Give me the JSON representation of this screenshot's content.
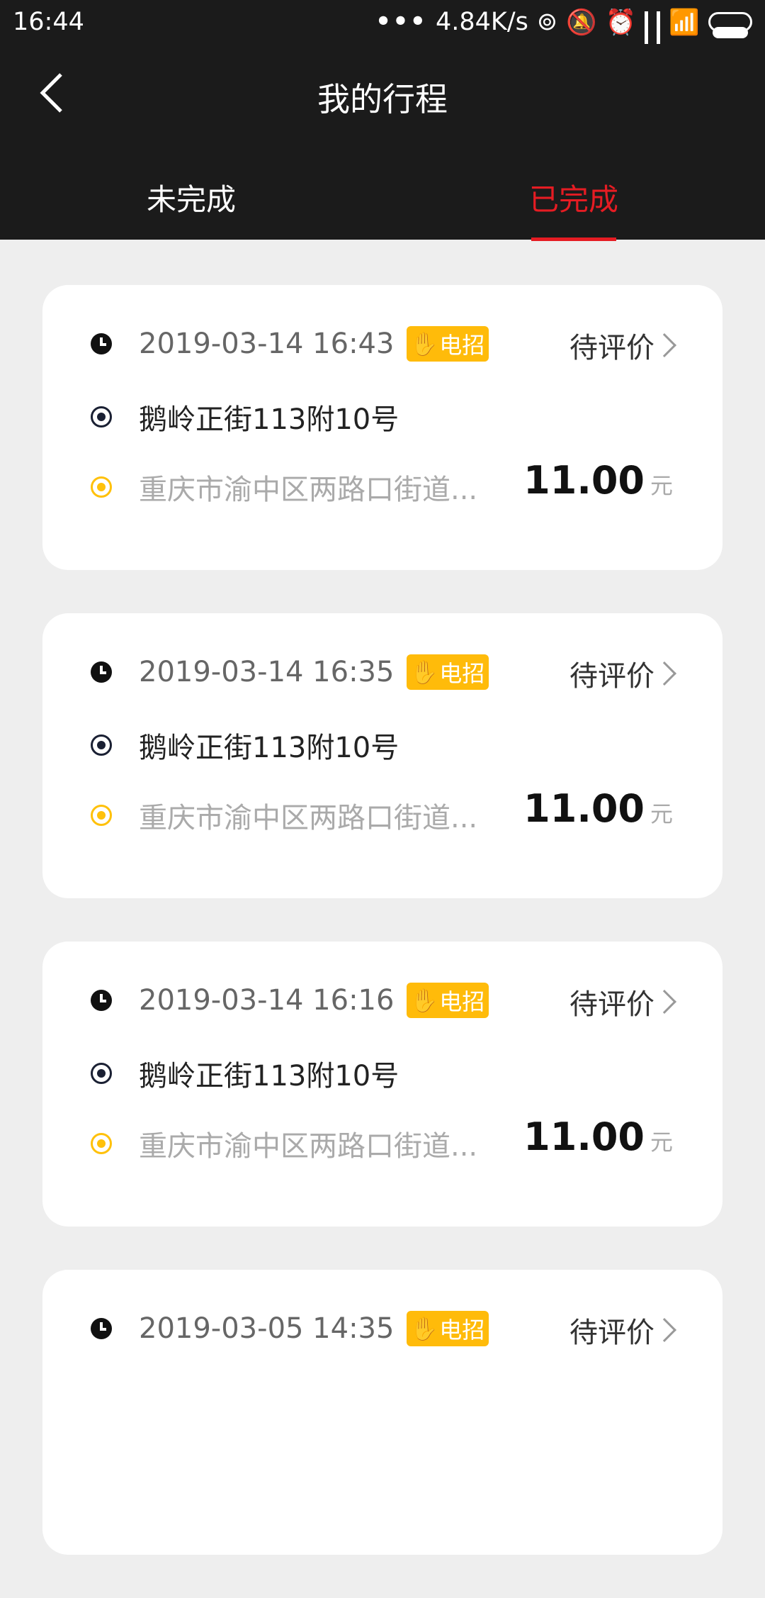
{
  "status_bar": {
    "time": "16:44",
    "network_speed": "4.84K/s",
    "icons": [
      "more-dots-icon",
      "hotspot-icon",
      "mute-icon",
      "alarm-icon",
      "signal-icon",
      "signal-icon",
      "wifi-icon",
      "battery-icon"
    ]
  },
  "header": {
    "back_icon": "chevron-left-icon",
    "title": "我的行程"
  },
  "tabs": [
    {
      "label": "未完成",
      "active": false
    },
    {
      "label": "已完成",
      "active": true
    }
  ],
  "colors": {
    "accent": "#e51c23",
    "header_bg": "#1b1b1b",
    "badge": "#ffbb0a",
    "destination_dot": "#ffc10a"
  },
  "trips": [
    {
      "time": "2019-03-14 16:43",
      "badge": "电招",
      "status": "待评价",
      "start": "鹅岭正街113附10号",
      "destination": "重庆市渝中区两路口街道...",
      "price": "11.00",
      "unit": "元"
    },
    {
      "time": "2019-03-14 16:35",
      "badge": "电招",
      "status": "待评价",
      "start": "鹅岭正街113附10号",
      "destination": "重庆市渝中区两路口街道...",
      "price": "11.00",
      "unit": "元"
    },
    {
      "time": "2019-03-14 16:16",
      "badge": "电招",
      "status": "待评价",
      "start": "鹅岭正街113附10号",
      "destination": "重庆市渝中区两路口街道...",
      "price": "11.00",
      "unit": "元"
    },
    {
      "time": "2019-03-05 14:35",
      "badge": "电招",
      "status": "待评价",
      "start": "",
      "destination": "",
      "price": "",
      "unit": ""
    }
  ]
}
